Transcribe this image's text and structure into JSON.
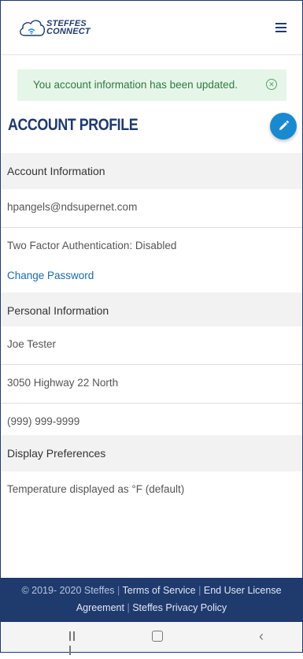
{
  "header": {
    "logo_line1": "STEFFES",
    "logo_line2": "CONNECT",
    "menu_icon": "hamburger-icon"
  },
  "alert": {
    "message": "You account information has been updated.",
    "close_icon": "close-circle-icon"
  },
  "page": {
    "title": "ACCOUNT PROFILE",
    "edit_icon": "pencil-icon",
    "accent_color": "#1a8ad0",
    "brand_color": "#1f3a6d"
  },
  "account": {
    "header": "Account Information",
    "email": "hpangels@ndsupernet.com",
    "two_factor": "Two Factor Authentication: Disabled",
    "change_password": "Change Password"
  },
  "personal": {
    "header": "Personal Information",
    "name": "Joe Tester",
    "address": "3050 Highway 22 North",
    "phone": "(999) 999-9999"
  },
  "display": {
    "header": "Display Preferences",
    "temperature": "Temperature displayed as °F (default)"
  },
  "footer": {
    "copyright": "© 2019- 2020 Steffes",
    "terms": "Terms of Service",
    "eula_part1": "End User License",
    "eula_part2": "Agreement",
    "privacy": "Steffes Privacy Policy"
  },
  "android_nav": {
    "recents_icon": "recents-icon",
    "home_icon": "home-icon",
    "back_icon": "back-icon"
  }
}
